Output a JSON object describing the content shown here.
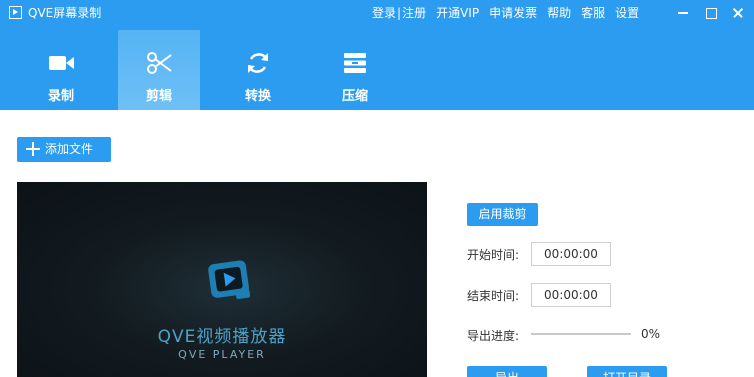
{
  "window": {
    "title": "QVE屏幕录制",
    "links": [
      "登录",
      "注册",
      "开通VIP",
      "申请发票",
      "帮助",
      "客服",
      "设置"
    ],
    "link_separator": "|"
  },
  "nav": {
    "tabs": [
      {
        "label": "录制",
        "icon": "video-camera-icon"
      },
      {
        "label": "剪辑",
        "icon": "scissors-icon",
        "active": true
      },
      {
        "label": "转换",
        "icon": "refresh-icon"
      },
      {
        "label": "压缩",
        "icon": "compress-icon"
      }
    ]
  },
  "toolbar": {
    "add_file_label": "添加文件"
  },
  "player": {
    "title": "QVE视频播放器",
    "subtitle": "QVE PLAYER"
  },
  "editor": {
    "crop_label": "启用裁剪",
    "start_label": "开始时间:",
    "start_value": "00:00:00",
    "end_label": "结束时间:",
    "end_value": "00:00:00",
    "progress_label": "导出进度:",
    "progress_value": 0,
    "progress_text": "0%",
    "export_label": "导出",
    "open_dir_label": "打开目录"
  },
  "colors": {
    "accent": "#2b9cef",
    "player_bg": "#10181c"
  }
}
